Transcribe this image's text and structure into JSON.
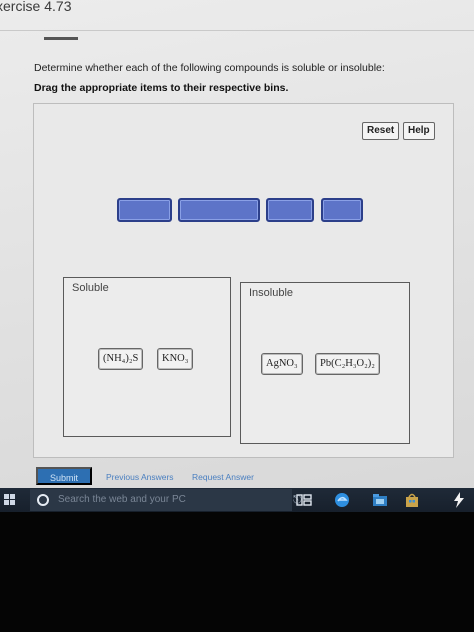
{
  "exercise_title": "xercise 4.73",
  "prompt": "Determine whether each of the following compounds is soluble or insoluble:",
  "instruction": "Drag the appropriate items to their respective bins.",
  "toolbar": {
    "reset_label": "Reset",
    "help_label": "Help"
  },
  "bins": {
    "soluble": {
      "label": "Soluble",
      "items": [
        "(NH₄)₂S",
        "KNO₃"
      ]
    },
    "insoluble": {
      "label": "Insoluble",
      "items": [
        "AgNO₃",
        "Pb(C₂H₃O₂)₂"
      ]
    }
  },
  "footer": {
    "submit_label": "Submit",
    "previous_answers": "Previous Answers",
    "request_answer": "Request Answer"
  },
  "taskbar": {
    "search_placeholder": "Search the web and your PC"
  },
  "colors": {
    "tile": "#5d74c8",
    "tile_border": "#2c3f8a",
    "submit": "#2d6fb2",
    "link": "#4a7fc0"
  }
}
